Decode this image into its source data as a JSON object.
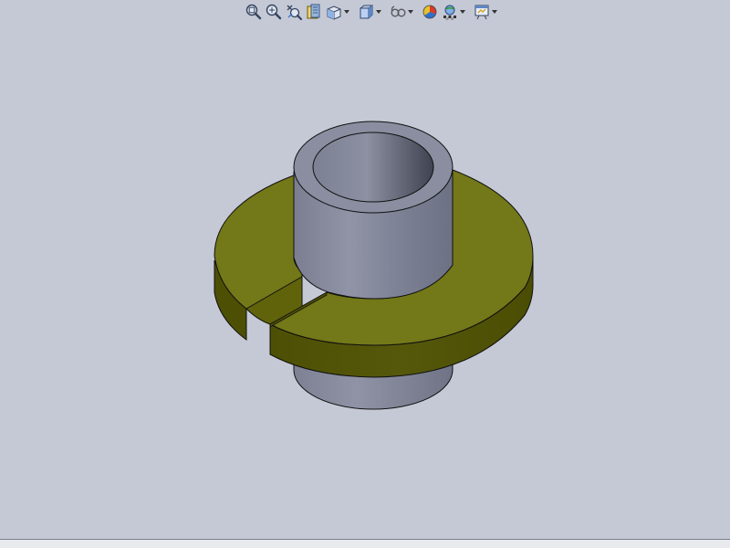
{
  "app": {
    "background_color": "#c5c9d5",
    "model_body_color": "#7f8293",
    "flange_top_color": "#737818",
    "flange_side_color": "#4d5004"
  },
  "toolbar": {
    "buttons": [
      {
        "name": "zoom-to-fit-button",
        "icon": "zoom-fit-icon",
        "has_dropdown": false
      },
      {
        "name": "zoom-to-area-button",
        "icon": "zoom-area-icon",
        "has_dropdown": false
      },
      {
        "name": "previous-view-button",
        "icon": "previous-view-icon",
        "has_dropdown": false
      },
      {
        "name": "section-view-button",
        "icon": "section-view-icon",
        "has_dropdown": false
      },
      {
        "name": "view-orientation-button",
        "icon": "view-orientation-icon",
        "has_dropdown": true
      },
      {
        "name": "display-style-button",
        "icon": "display-style-icon",
        "has_dropdown": true
      },
      {
        "name": "hide-show-items-button",
        "icon": "hide-show-icon",
        "has_dropdown": true
      },
      {
        "name": "edit-appearance-button",
        "icon": "appearance-icon",
        "has_dropdown": false
      },
      {
        "name": "apply-scene-button",
        "icon": "scene-icon",
        "has_dropdown": true
      },
      {
        "name": "view-settings-button",
        "icon": "view-settings-icon",
        "has_dropdown": true
      }
    ]
  }
}
